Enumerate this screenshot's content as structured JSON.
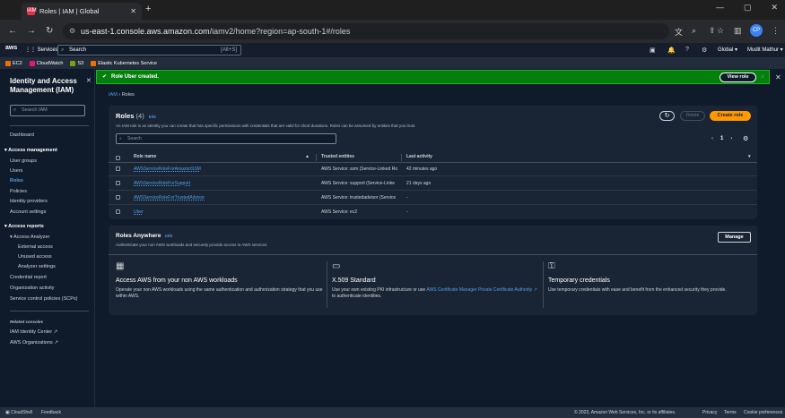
{
  "browser": {
    "tab_title": "Roles | IAM | Global",
    "tab_favicon": "IAM",
    "new_tab": "+",
    "url_host": "us-east-1.console.aws.amazon.com",
    "url_path": "/iamv2/home?region=ap-south-1#/roles",
    "profile_initials": "CP"
  },
  "aws_nav": {
    "logo": "aws",
    "services": "Services",
    "search_placeholder": "Search",
    "search_hint": "[Alt+S]",
    "region": "Global ▾",
    "user": "Mudit Mathur ▾"
  },
  "favorites": [
    {
      "label": "EC2",
      "color": "#ed7100"
    },
    {
      "label": "CloudWatch",
      "color": "#e7157b"
    },
    {
      "label": "S3",
      "color": "#7aa116"
    },
    {
      "label": "Elastic Kubernetes Service",
      "color": "#ed7100"
    }
  ],
  "sidebar": {
    "title": "Identity and Access Management (IAM)",
    "search_placeholder": "Search IAM",
    "dashboard": "Dashboard",
    "access_management": "Access management",
    "user_groups": "User groups",
    "users": "Users",
    "roles": "Roles",
    "policies": "Policies",
    "identity_providers": "Identity providers",
    "account_settings": "Account settings",
    "access_reports": "Access reports",
    "access_analyzer": "Access Analyzer",
    "external_access": "External access",
    "unused_access": "Unused access",
    "analyzer_settings": "Analyzer settings",
    "credential_report": "Credential report",
    "organization_activity": "Organization activity",
    "scps": "Service control policies (SCPs)",
    "related_consoles": "Related consoles",
    "iam_identity_center": "IAM Identity Center",
    "aws_organizations": "AWS Organizations"
  },
  "flash": {
    "message": "Role Uber created.",
    "view_role": "View role"
  },
  "breadcrumb": {
    "root": "IAM",
    "current": "Roles"
  },
  "roles": {
    "title": "Roles",
    "count": "(4)",
    "info": "Info",
    "description": "An IAM role is an identity you can create that has specific permissions with credentials that are valid for short durations. Roles can be assumed by entities that you trust.",
    "delete": "Delete",
    "create": "Create role",
    "search_placeholder": "Search",
    "page": "1",
    "columns": {
      "name": "Role name",
      "trusted": "Trusted entities",
      "last": "Last activity"
    },
    "rows": [
      {
        "name": "AWSServiceRoleForAmazonSSM",
        "trusted": "AWS Service: ssm (Service-Linked Ro",
        "last": "42 minutes ago"
      },
      {
        "name": "AWSServiceRoleForSupport",
        "trusted": "AWS Service: support (Service-Linke",
        "last": "21 days ago"
      },
      {
        "name": "AWSServiceRoleForTrustedAdvisor",
        "trusted": "AWS Service: trustedadvisor (Service",
        "last": "-"
      },
      {
        "name": "Uber",
        "trusted": "AWS Service: ec2",
        "last": "-"
      }
    ]
  },
  "anywhere": {
    "title": "Roles Anywhere",
    "info": "Info",
    "description": "Authenticate your non AWS workloads and securely provide access to AWS services.",
    "manage": "Manage",
    "features": [
      {
        "title": "Access AWS from your non AWS workloads",
        "desc": "Operate your non AWS workloads using the same authentication and authorization strategy that you use within AWS."
      },
      {
        "title": "X.509 Standard",
        "desc_pre": "Use your own existing PKI infrastructure or use ",
        "desc_link": "AWS Certificate Manager Private Certificate Authority",
        "desc_post": " to authenticate identities."
      },
      {
        "title": "Temporary credentials",
        "desc": "Use temporary credentials with ease and benefit from the enhanced security they provide."
      }
    ]
  },
  "footer": {
    "cloudshell": "CloudShell",
    "feedback": "Feedback",
    "copyright": "© 2023, Amazon Web Services, Inc. or its affiliates.",
    "privacy": "Privacy",
    "terms": "Terms",
    "cookies": "Cookie preferences"
  }
}
